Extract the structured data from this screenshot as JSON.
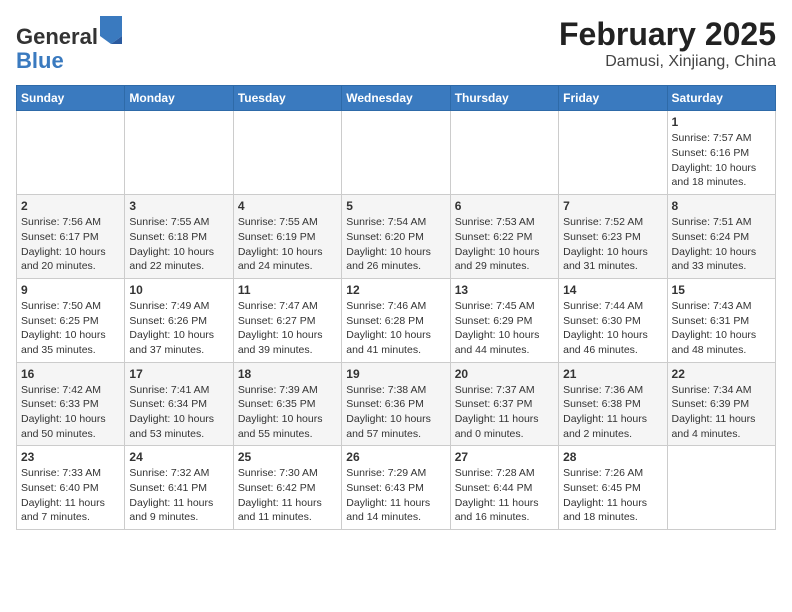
{
  "header": {
    "logo_general": "General",
    "logo_blue": "Blue",
    "title": "February 2025",
    "subtitle": "Damusi, Xinjiang, China"
  },
  "weekdays": [
    "Sunday",
    "Monday",
    "Tuesday",
    "Wednesday",
    "Thursday",
    "Friday",
    "Saturday"
  ],
  "weeks": [
    [
      {
        "day": "",
        "info": ""
      },
      {
        "day": "",
        "info": ""
      },
      {
        "day": "",
        "info": ""
      },
      {
        "day": "",
        "info": ""
      },
      {
        "day": "",
        "info": ""
      },
      {
        "day": "",
        "info": ""
      },
      {
        "day": "1",
        "info": "Sunrise: 7:57 AM\nSunset: 6:16 PM\nDaylight: 10 hours\nand 18 minutes."
      }
    ],
    [
      {
        "day": "2",
        "info": "Sunrise: 7:56 AM\nSunset: 6:17 PM\nDaylight: 10 hours\nand 20 minutes."
      },
      {
        "day": "3",
        "info": "Sunrise: 7:55 AM\nSunset: 6:18 PM\nDaylight: 10 hours\nand 22 minutes."
      },
      {
        "day": "4",
        "info": "Sunrise: 7:55 AM\nSunset: 6:19 PM\nDaylight: 10 hours\nand 24 minutes."
      },
      {
        "day": "5",
        "info": "Sunrise: 7:54 AM\nSunset: 6:20 PM\nDaylight: 10 hours\nand 26 minutes."
      },
      {
        "day": "6",
        "info": "Sunrise: 7:53 AM\nSunset: 6:22 PM\nDaylight: 10 hours\nand 29 minutes."
      },
      {
        "day": "7",
        "info": "Sunrise: 7:52 AM\nSunset: 6:23 PM\nDaylight: 10 hours\nand 31 minutes."
      },
      {
        "day": "8",
        "info": "Sunrise: 7:51 AM\nSunset: 6:24 PM\nDaylight: 10 hours\nand 33 minutes."
      }
    ],
    [
      {
        "day": "9",
        "info": "Sunrise: 7:50 AM\nSunset: 6:25 PM\nDaylight: 10 hours\nand 35 minutes."
      },
      {
        "day": "10",
        "info": "Sunrise: 7:49 AM\nSunset: 6:26 PM\nDaylight: 10 hours\nand 37 minutes."
      },
      {
        "day": "11",
        "info": "Sunrise: 7:47 AM\nSunset: 6:27 PM\nDaylight: 10 hours\nand 39 minutes."
      },
      {
        "day": "12",
        "info": "Sunrise: 7:46 AM\nSunset: 6:28 PM\nDaylight: 10 hours\nand 41 minutes."
      },
      {
        "day": "13",
        "info": "Sunrise: 7:45 AM\nSunset: 6:29 PM\nDaylight: 10 hours\nand 44 minutes."
      },
      {
        "day": "14",
        "info": "Sunrise: 7:44 AM\nSunset: 6:30 PM\nDaylight: 10 hours\nand 46 minutes."
      },
      {
        "day": "15",
        "info": "Sunrise: 7:43 AM\nSunset: 6:31 PM\nDaylight: 10 hours\nand 48 minutes."
      }
    ],
    [
      {
        "day": "16",
        "info": "Sunrise: 7:42 AM\nSunset: 6:33 PM\nDaylight: 10 hours\nand 50 minutes."
      },
      {
        "day": "17",
        "info": "Sunrise: 7:41 AM\nSunset: 6:34 PM\nDaylight: 10 hours\nand 53 minutes."
      },
      {
        "day": "18",
        "info": "Sunrise: 7:39 AM\nSunset: 6:35 PM\nDaylight: 10 hours\nand 55 minutes."
      },
      {
        "day": "19",
        "info": "Sunrise: 7:38 AM\nSunset: 6:36 PM\nDaylight: 10 hours\nand 57 minutes."
      },
      {
        "day": "20",
        "info": "Sunrise: 7:37 AM\nSunset: 6:37 PM\nDaylight: 11 hours\nand 0 minutes."
      },
      {
        "day": "21",
        "info": "Sunrise: 7:36 AM\nSunset: 6:38 PM\nDaylight: 11 hours\nand 2 minutes."
      },
      {
        "day": "22",
        "info": "Sunrise: 7:34 AM\nSunset: 6:39 PM\nDaylight: 11 hours\nand 4 minutes."
      }
    ],
    [
      {
        "day": "23",
        "info": "Sunrise: 7:33 AM\nSunset: 6:40 PM\nDaylight: 11 hours\nand 7 minutes."
      },
      {
        "day": "24",
        "info": "Sunrise: 7:32 AM\nSunset: 6:41 PM\nDaylight: 11 hours\nand 9 minutes."
      },
      {
        "day": "25",
        "info": "Sunrise: 7:30 AM\nSunset: 6:42 PM\nDaylight: 11 hours\nand 11 minutes."
      },
      {
        "day": "26",
        "info": "Sunrise: 7:29 AM\nSunset: 6:43 PM\nDaylight: 11 hours\nand 14 minutes."
      },
      {
        "day": "27",
        "info": "Sunrise: 7:28 AM\nSunset: 6:44 PM\nDaylight: 11 hours\nand 16 minutes."
      },
      {
        "day": "28",
        "info": "Sunrise: 7:26 AM\nSunset: 6:45 PM\nDaylight: 11 hours\nand 18 minutes."
      },
      {
        "day": "",
        "info": ""
      }
    ]
  ]
}
